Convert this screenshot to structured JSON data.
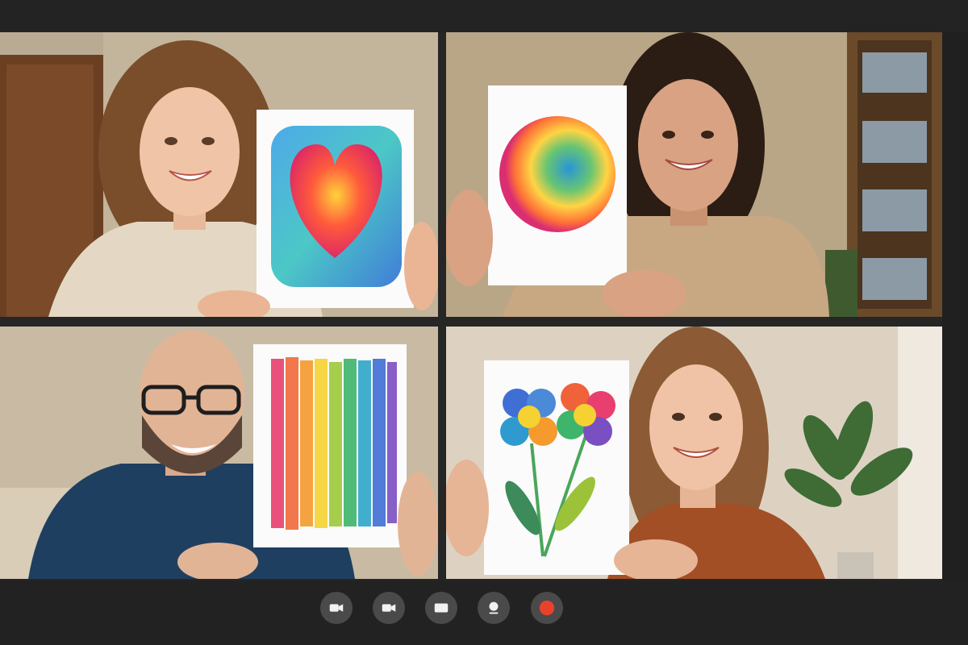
{
  "window": {
    "background": "#262626"
  },
  "participants": [
    {
      "drawing": "heart-painting"
    },
    {
      "drawing": "circle-painting"
    },
    {
      "drawing": "rainbow-stripes-painting"
    },
    {
      "drawing": "flowers-painting"
    }
  ],
  "controls": [
    {
      "name": "camera-button",
      "icon": "video-camera-icon"
    },
    {
      "name": "video-button",
      "icon": "video-camera-icon"
    },
    {
      "name": "screen-button",
      "icon": "screen-icon"
    },
    {
      "name": "profile-button",
      "icon": "person-icon"
    },
    {
      "name": "record-button",
      "icon": "record-icon",
      "color": "#e8412c"
    }
  ],
  "colors": {
    "control_bg": "#4a4a4a",
    "record": "#e8412c",
    "icon": "#f2f2f2"
  }
}
